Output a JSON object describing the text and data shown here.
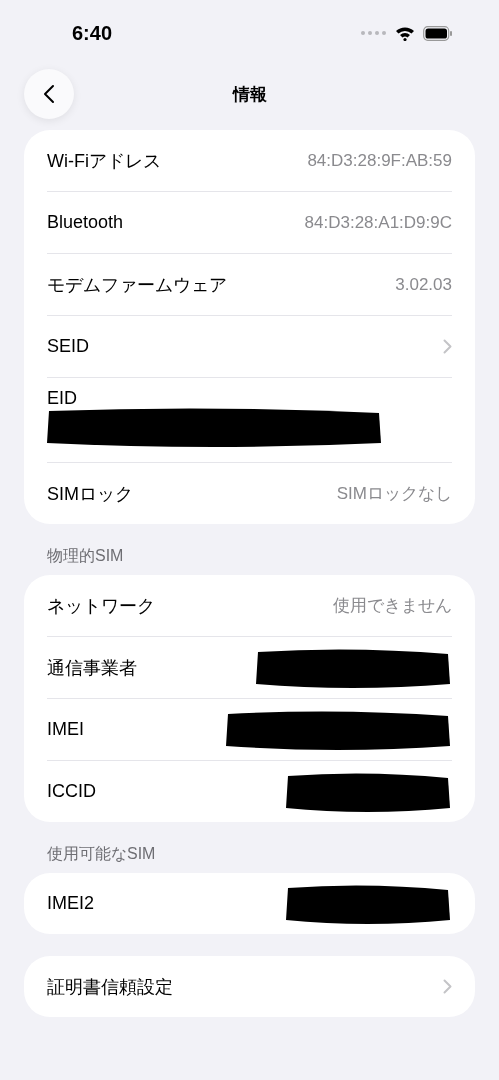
{
  "status_bar": {
    "time": "6:40"
  },
  "nav": {
    "title": "情報"
  },
  "sections": [
    {
      "rows": [
        {
          "kind": "value",
          "label": "Wi-Fiアドレス",
          "value": "84:D3:28:9F:AB:59"
        },
        {
          "kind": "value",
          "label": "Bluetooth",
          "value": "84:D3:28:A1:D9:9C"
        },
        {
          "kind": "value",
          "label": "モデムファームウェア",
          "value": "3.02.03"
        },
        {
          "kind": "link",
          "label": "SEID"
        },
        {
          "kind": "stacked",
          "label": "EID",
          "redacted": true
        },
        {
          "kind": "value",
          "label": "SIMロック",
          "value": "SIMロックなし"
        }
      ]
    },
    {
      "header": "物理的SIM",
      "rows": [
        {
          "kind": "value",
          "label": "ネットワーク",
          "value": "使用できません"
        },
        {
          "kind": "value",
          "label": "通信事業者",
          "redacted": true
        },
        {
          "kind": "value",
          "label": "IMEI",
          "redacted": true
        },
        {
          "kind": "value",
          "label": "ICCID",
          "redacted": true
        }
      ]
    },
    {
      "header": "使用可能なSIM",
      "rows": [
        {
          "kind": "value",
          "label": "IMEI2",
          "redacted": true
        }
      ]
    },
    {
      "rows": [
        {
          "kind": "link",
          "label": "証明書信頼設定"
        }
      ]
    }
  ]
}
